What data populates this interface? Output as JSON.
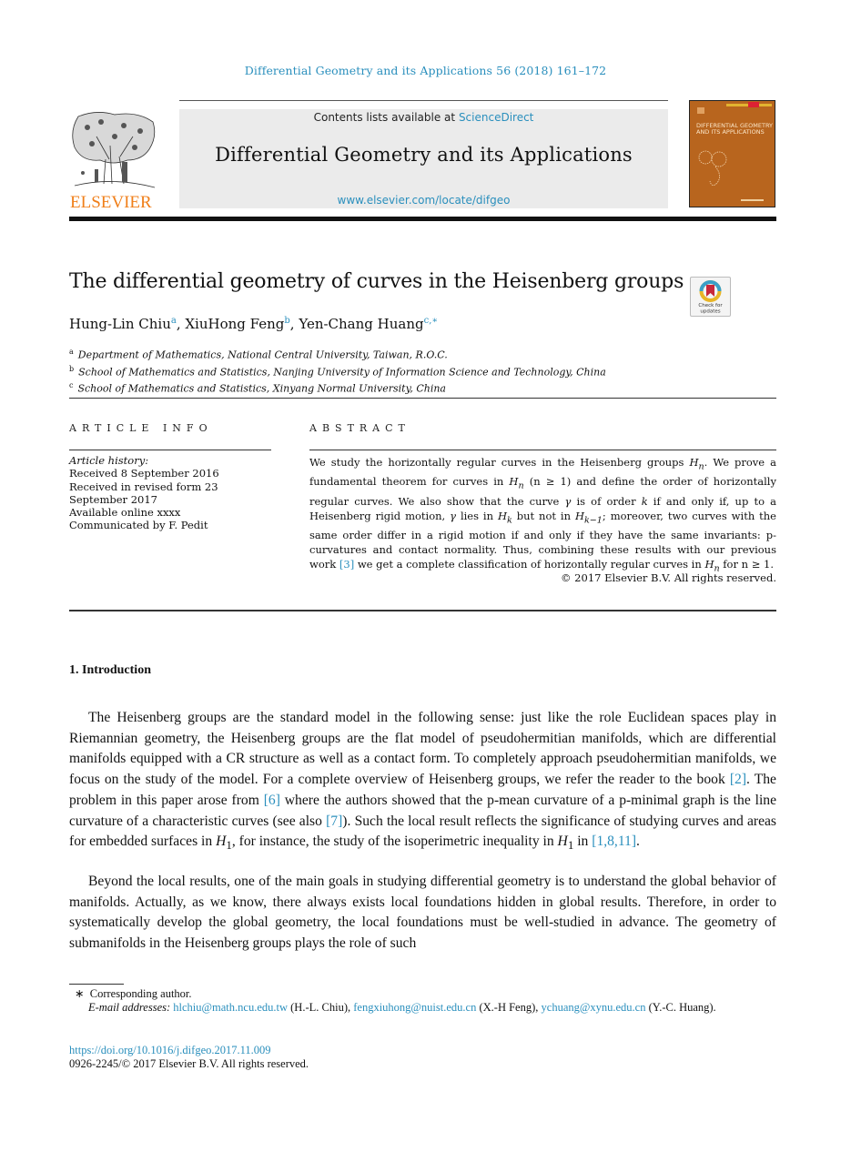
{
  "header": {
    "journal_reference": "Differential Geometry and its Applications 56 (2018) 161–172",
    "contents_prefix": "Contents lists available at ",
    "contents_link": "ScienceDirect",
    "journal_title": "Differential Geometry and its Applications",
    "journal_url": "www.elsevier.com/locate/difgeo",
    "publisher_logo_text": "ELSEVIER",
    "cover_title": "DIFFERENTIAL GEOMETRY AND ITS APPLICATIONS",
    "check_updates_label": "Check for updates"
  },
  "colors": {
    "link": "#2a8fbd",
    "elsevier_orange": "#f07f1a",
    "cover": "#b8651e",
    "banner_bg": "#ebebeb"
  },
  "article": {
    "title": "The differential geometry of curves in the Heisenberg groups",
    "authors": [
      {
        "name": "Hung-Lin Chiu",
        "sup": "a"
      },
      {
        "name": "XiuHong Feng",
        "sup": "b"
      },
      {
        "name": "Yen-Chang Huang",
        "sup": "c,∗"
      }
    ],
    "affiliations": [
      {
        "sup": "a",
        "text": "Department of Mathematics, National Central University, Taiwan, R.O.C."
      },
      {
        "sup": "b",
        "text": "School of Mathematics and Statistics, Nanjing University of Information Science and Technology, China"
      },
      {
        "sup": "c",
        "text": "School of Mathematics and Statistics, Xinyang Normal University, China"
      }
    ]
  },
  "article_info": {
    "label": "ARTICLE INFO",
    "history_label": "Article history:",
    "lines": [
      "Received 8 September 2016",
      "Received in revised form 23",
      "September 2017",
      "Available online xxxx",
      "Communicated by F. Pedit"
    ]
  },
  "abstract": {
    "label": "ABSTRACT",
    "s1": "We study the horizontally regular curves in the Heisenberg groups ",
    "s2": ". We prove a fundamental theorem for curves in ",
    "s3": " and define the order of horizontally regular curves. We also show that the curve ",
    "s4": " is of order ",
    "s5": " if and only if, up to a Heisenberg rigid motion, ",
    "s6": " lies in ",
    "s7": " but not in ",
    "s8": "; moreover, two curves with the same order differ in a rigid motion if and only if they have the same invariants: p-curvatures and contact normality. Thus, combining these results with our previous work ",
    "ref": "[3]",
    "s9": " we get a complete classification of horizontally regular curves in ",
    "s10": " for ",
    "s11": ".",
    "math": {
      "Hn": "H",
      "n_sub": "n",
      "n_ge_1": "(n ≥ 1)",
      "gamma": "γ",
      "k": "k",
      "Hk_sub": "k",
      "Hk1_sub": "k−1",
      "n_ge_1_plain": "n ≥ 1"
    },
    "copyright": "© 2017 Elsevier B.V. All rights reserved."
  },
  "introduction": {
    "heading": "1.  Introduction",
    "p1": {
      "a": "The Heisenberg groups are the standard model in the following sense: just like the role Euclidean spaces play in Riemannian geometry, the Heisenberg groups are the flat model of pseudohermitian manifolds, which are differential manifolds equipped with a CR structure as well as a contact form. To completely approach pseudohermitian manifolds, we focus on the study of the model. For a complete overview of Heisenberg groups, we refer the reader to the book ",
      "ref1": "[2]",
      "b": ". The problem in this paper arose from ",
      "ref2": "[6]",
      "c": " where the authors showed that the p-mean curvature of a p-minimal graph is the line curvature of a characteristic curves (see also ",
      "ref3": "[7]",
      "d": "). Such the local result reflects the significance of studying curves and areas for embedded surfaces in ",
      "h1": "H",
      "h1_sub": "1",
      "e": ", for instance, the study of the isoperimetric inequality in ",
      "f": " in ",
      "ref4": "[1,8,11]",
      "g": "."
    },
    "p2": "Beyond the local results, one of the main goals in studying differential geometry is to understand the global behavior of manifolds. Actually, as we know, there always exists local foundations hidden in global results. Therefore, in order to systematically develop the global geometry, the local foundations must be well-studied in advance. The geometry of submanifolds in the Heisenberg groups plays the role of such"
  },
  "footnotes": {
    "star": "∗",
    "corresponding": "Corresponding author.",
    "emails_label": "E-mail addresses:",
    "emails": [
      {
        "address": "hlchiu@math.ncu.edu.tw",
        "who": " (H.-L. Chiu), "
      },
      {
        "address": "fengxiuhong@nuist.edu.cn",
        "who": " (X.-H Feng), "
      },
      {
        "address": "ychuang@xynu.edu.cn",
        "who": " (Y.-C. Huang)."
      }
    ],
    "doi": "https://doi.org/10.1016/j.difgeo.2017.11.009",
    "issn": "0926-2245/© 2017 Elsevier B.V. All rights reserved."
  }
}
